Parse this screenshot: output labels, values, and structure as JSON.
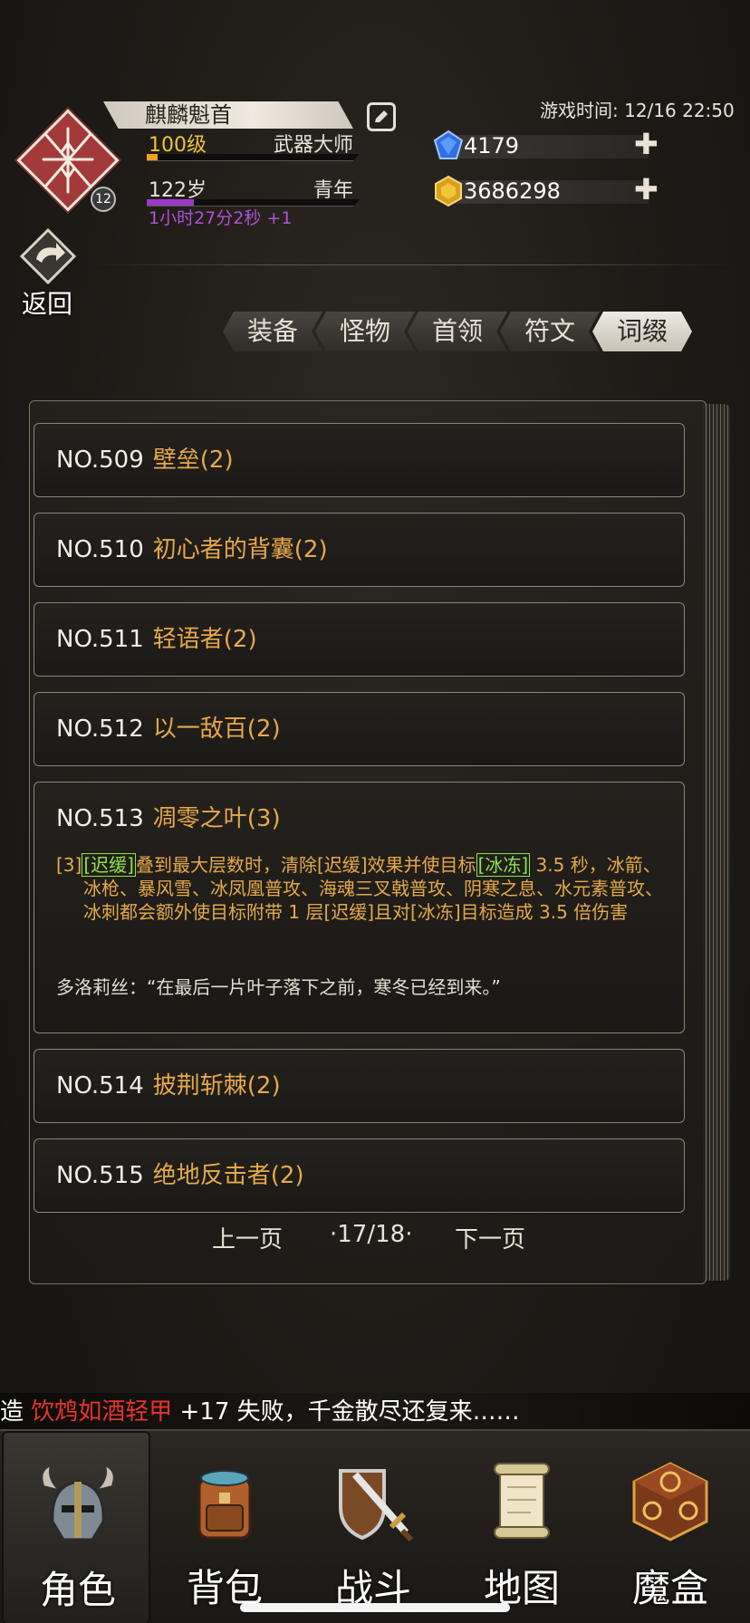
{
  "header": {
    "character_name": "麒麟魁首",
    "level": "100级",
    "title": "武器大师",
    "level_progress": 0.05,
    "age": "122岁",
    "life_stage": "青年",
    "age_progress": 0.22,
    "timer": "1小时27分2秒 +1",
    "avatar_badge": "12",
    "game_time": "游戏时间: 12/16 22:50",
    "diamonds": "4179",
    "gold": "3686298",
    "back_label": "返回"
  },
  "tabs": [
    {
      "label": "装备"
    },
    {
      "label": "怪物"
    },
    {
      "label": "首领"
    },
    {
      "label": "符文"
    },
    {
      "label": "词缀",
      "active": true
    }
  ],
  "entries": [
    {
      "no": "NO.509",
      "title": "壁垒(2)"
    },
    {
      "no": "NO.510",
      "title": "初心者的背囊(2)"
    },
    {
      "no": "NO.511",
      "title": "轻语者(2)"
    },
    {
      "no": "NO.512",
      "title": "以一敌百(2)"
    },
    {
      "no": "NO.513",
      "title": "凋零之叶(3)",
      "desc_prefix": "[3]",
      "kw1": "[迟缓]",
      "desc_mid": "叠到最大层数时，清除[迟缓]效果并使目标",
      "kw2": "[冰冻]",
      "desc_rest": " 3.5 秒，冰箭、冰枪、暴风雪、冰凤凰普攻、海魂三叉戟普攻、阴寒之息、水元素普攻、冰刺都会额外使目标附带 1 层[迟缓]且对[冰冻]目标造成 3.5 倍伤害",
      "quote": "多洛莉丝：“在最后一片叶子落下之前，寒冬已经到来。”"
    },
    {
      "no": "NO.514",
      "title": "披荆斩棘(2)"
    },
    {
      "no": "NO.515",
      "title": "绝地反击者(2)"
    }
  ],
  "pager": {
    "prev": "上一页",
    "page": "·17/18·",
    "next": "下一页"
  },
  "ticker": {
    "prefix": "锻造 ",
    "item": "饮鸩如酒轻甲",
    "suffix": " +17 失败，千金散尽还复来……"
  },
  "nav": [
    {
      "label": "角色",
      "icon": "helmet-icon"
    },
    {
      "label": "背包",
      "icon": "backpack-icon"
    },
    {
      "label": "战斗",
      "icon": "sword-shield-icon"
    },
    {
      "label": "地图",
      "icon": "scroll-map-icon"
    },
    {
      "label": "魔盒",
      "icon": "magic-box-icon"
    }
  ]
}
